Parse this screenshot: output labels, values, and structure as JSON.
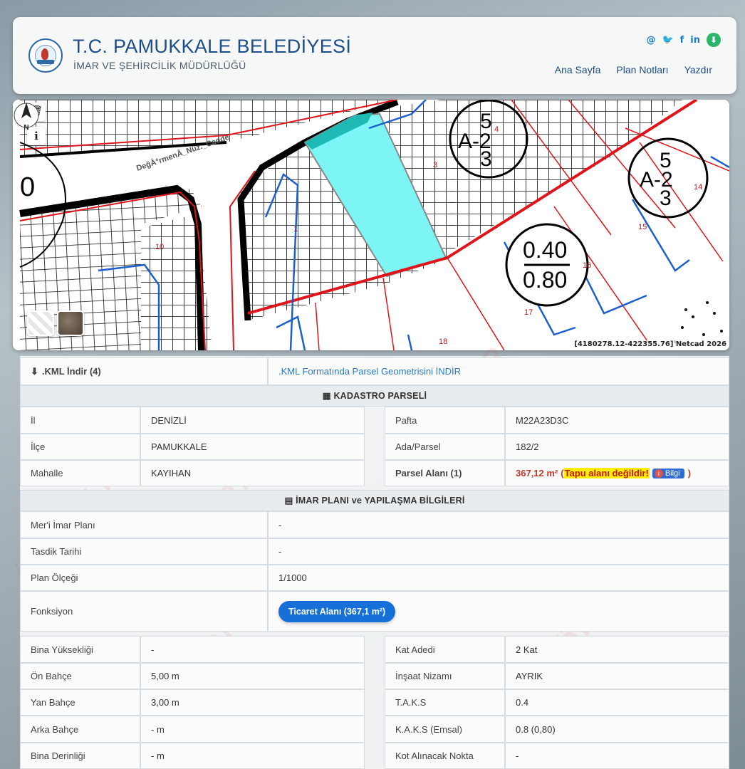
{
  "header": {
    "title": "T.C. PAMUKKALE BELEDİYESİ",
    "subtitle": "İMAR VE ŞEHİRCİLİK MÜDÜRLÜĞÜ",
    "social": {
      "email": "@",
      "twitter": "🐦",
      "facebook": "f",
      "linkedin": "in",
      "download": "⬇"
    },
    "nav": [
      "Ana Sayfa",
      "Plan Notları",
      "Yazdır"
    ]
  },
  "map": {
    "street_label": "DeğÄ°rmenÅ_Nüz._Cadde",
    "coords": "[4180278.12-422355.76] Netcad 2026",
    "zone_label_1": {
      "top": "5",
      "mid": "A-2",
      "bottom": "3"
    },
    "zone_label_2": {
      "top": "5",
      "mid": "A-2",
      "bottom": "3"
    },
    "ratio_top": "0.40",
    "ratio_bottom": "0.80",
    "zero_label": "0",
    "parcel_numbers": [
      "4",
      "3",
      "14",
      "15",
      "16",
      "17",
      "18",
      "1",
      "10"
    ],
    "compass_label": "N",
    "delete_icon": "🗑",
    "info_icon": "i"
  },
  "kml": {
    "label": ".KML İndir (4)",
    "link": ".KML Formatında Parsel Geometrisini İNDİR"
  },
  "kadastro": {
    "heading": "KADASTRO PARSELİ",
    "left": [
      {
        "label": "İl",
        "value": "DENİZLİ"
      },
      {
        "label": "İlçe",
        "value": "PAMUKKALE"
      },
      {
        "label": "Mahalle",
        "value": "KAYIHAN"
      }
    ],
    "right": [
      {
        "label": "Pafta",
        "value": "M22A23D3C"
      },
      {
        "label": "Ada/Parsel",
        "value": "182/2"
      },
      {
        "label": "Parsel Alanı (1)",
        "value": "367,12 m²"
      }
    ],
    "area_open": "(",
    "area_warning": "Tapu alanı değildir!",
    "bilgi_button": "Bilgi",
    "area_close": ")"
  },
  "imar": {
    "heading": "İMAR PLANI ve YAPILAŞMA BİLGİLERİ",
    "rows": [
      {
        "label": "Mer'i İmar Planı",
        "value": "-"
      },
      {
        "label": "Tasdik Tarihi",
        "value": "-"
      },
      {
        "label": "Plan Ölçeği",
        "value": "1/1000"
      }
    ],
    "function_label": "Fonksiyon",
    "function_button": "Ticaret Alanı (367,1 m²)"
  },
  "yapilasma": {
    "left": [
      {
        "label": "Bina Yüksekliği",
        "value": "-"
      },
      {
        "label": "Ön Bahçe",
        "value": "5,00 m"
      },
      {
        "label": "Yan Bahçe",
        "value": "3,00 m"
      },
      {
        "label": "Arka Bahçe",
        "value": "- m"
      },
      {
        "label": "Bina Derinliği",
        "value": "- m"
      }
    ],
    "right": [
      {
        "label": "Kat Adedi",
        "value": "2 Kat"
      },
      {
        "label": "İnşaat Nizamı",
        "value": "AYRIK"
      },
      {
        "label": "T.A.K.S",
        "value": "0.4"
      },
      {
        "label": "K.A.K.S (Emsal)",
        "value": "0.8 (0,80)"
      },
      {
        "label": "Kot Alınacak Nokta",
        "value": "-"
      }
    ]
  },
  "watermark_text": "ÖRNEKTİR",
  "colors": {
    "brand": "#1d4e89",
    "parcel": "#7df5f5",
    "zone_line": "#e0141b",
    "plan_line": "#1e5fd0",
    "button": "#1670d8"
  }
}
